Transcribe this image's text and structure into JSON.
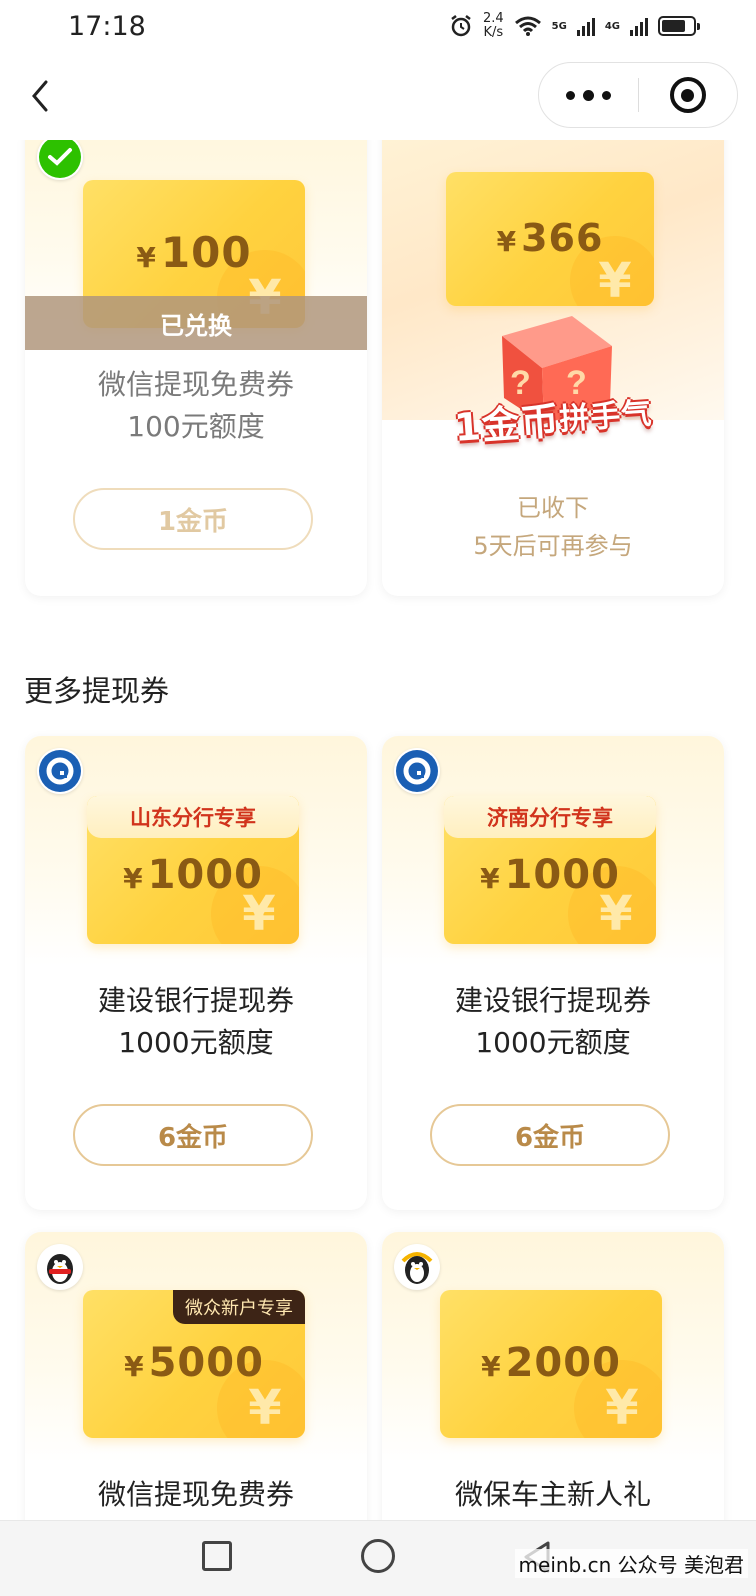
{
  "status_bar": {
    "time": "17:18",
    "net_speed_value": "2.4",
    "net_speed_unit": "K/s",
    "sig1": "5G",
    "sig2": "4G"
  },
  "nav": {
    "more_icon": "more-dots-icon",
    "close_icon": "target-close-icon"
  },
  "cards_top": [
    {
      "amount": "100",
      "currency": "¥",
      "coin_glyph": "¥",
      "redeemed_label": "已兑换",
      "title_line1": "微信提现免费券",
      "title_line2": "100元额度",
      "button": "1金币",
      "badge_icon": "wechat-pay-icon"
    },
    {
      "amount": "366",
      "currency": "¥",
      "coin_glyph": "¥",
      "promo_big": "1金币",
      "promo_small": "拼手气",
      "status_line1": "已收下",
      "status_line2": "5天后可再参与"
    }
  ],
  "section_title": "更多提现券",
  "cards_more": [
    {
      "tag": "山东分行专享",
      "currency": "¥",
      "amount": "1000",
      "coin_glyph": "¥",
      "title_line1": "建设银行提现券",
      "title_line2": "1000元额度",
      "button": "6金币",
      "badge_icon": "ccb-bank-icon"
    },
    {
      "tag": "济南分行专享",
      "currency": "¥",
      "amount": "1000",
      "coin_glyph": "¥",
      "title_line1": "建设银行提现券",
      "title_line2": "1000元额度",
      "button": "6金币",
      "badge_icon": "ccb-bank-icon"
    },
    {
      "tag": "微众新户专享",
      "currency": "¥",
      "amount": "5000",
      "coin_glyph": "¥",
      "title_line1": "微信提现免费券",
      "badge_icon": "webank-penguin-icon"
    },
    {
      "currency": "¥",
      "amount": "2000",
      "coin_glyph": "¥",
      "title_line1": "微保车主新人礼",
      "badge_icon": "wesure-penguin-icon"
    }
  ],
  "watermark": "meinb.cn  公众号 美泡君",
  "colors": {
    "accent_gold": "#b98a49",
    "voucher_yellow": "#ffd23f",
    "tag_red": "#d1331c",
    "ccb_blue": "#1a5fb4",
    "wechat_green": "#2dc100"
  }
}
